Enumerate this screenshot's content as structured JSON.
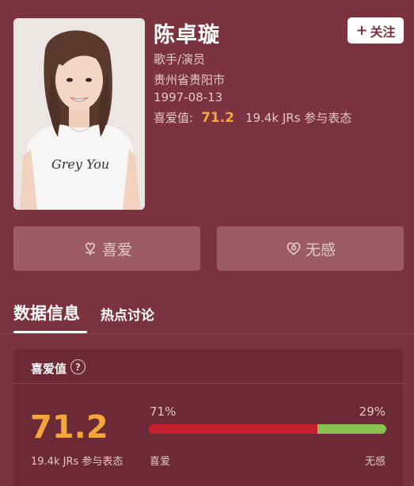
{
  "profile": {
    "name": "陈卓璇",
    "occupation": "歌手/演员",
    "location": "贵州省贵阳市",
    "birthday": "1997-08-13",
    "score_label": "喜爱值:",
    "score_value": "71.2",
    "participants": "19.4k JRs 参与表态",
    "avatar_icon": "person-photo",
    "shirt_text": "Grey You"
  },
  "follow": {
    "plus": "+",
    "label": "关注"
  },
  "vote": {
    "like_label": "喜爱",
    "like_icon": "flower-heart-icon",
    "dislike_label": "无感",
    "dislike_icon": "neutral-heart-icon"
  },
  "tabs": [
    {
      "label": "数据信息",
      "active": true
    },
    {
      "label": "热点讨论",
      "active": false
    }
  ],
  "stats": {
    "title": "喜爱值",
    "help": "?",
    "score": "71.2",
    "participants": "19.4k JRs 参与表态",
    "like_percent_text": "71%",
    "dislike_percent_text": "29%",
    "like_fraction": 0.71,
    "like_label": "喜爱",
    "dislike_label": "无感"
  },
  "colors": {
    "background": "#7c3340",
    "accent_score": "#f4a63a",
    "like_bar": "#c8202f",
    "dislike_bar": "#86c34f"
  }
}
